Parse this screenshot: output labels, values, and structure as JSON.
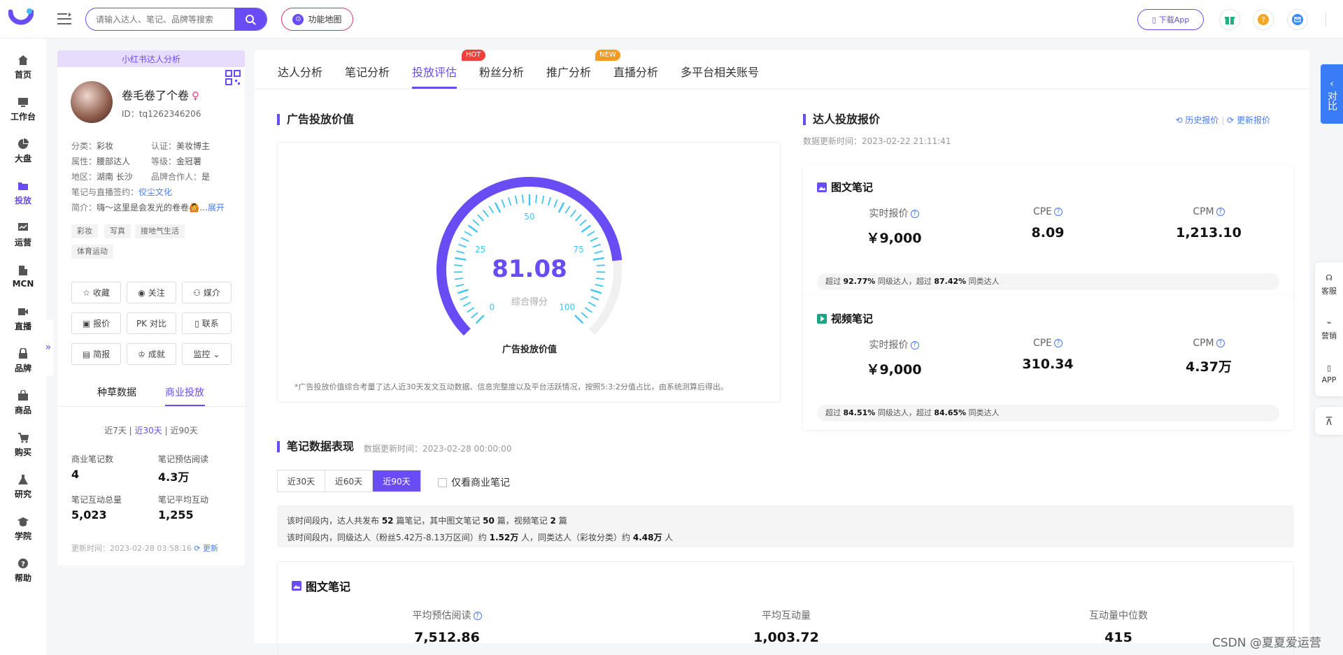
{
  "header": {
    "search_placeholder": "请输入达人、笔记、品牌等搜索",
    "feature_map": "功能地图",
    "download_app": "下载App"
  },
  "nav": [
    {
      "label": "首页",
      "icon": "home-icon"
    },
    {
      "label": "工作台",
      "icon": "workbench-icon"
    },
    {
      "label": "大盘",
      "icon": "pie-icon"
    },
    {
      "label": "投放",
      "icon": "folder-icon"
    },
    {
      "label": "运营",
      "icon": "chart-icon"
    },
    {
      "label": "MCN",
      "icon": "building-icon"
    },
    {
      "label": "直播",
      "icon": "video-icon"
    },
    {
      "label": "品牌",
      "icon": "lock-icon"
    },
    {
      "label": "商品",
      "icon": "bag-icon"
    },
    {
      "label": "购买",
      "icon": "cart-icon"
    },
    {
      "label": "研究",
      "icon": "flask-icon"
    },
    {
      "label": "学院",
      "icon": "cap-icon"
    },
    {
      "label": "帮助",
      "icon": "help-icon"
    }
  ],
  "profile": {
    "header": "小红书达人分析",
    "name": "卷毛卷了个卷",
    "gender": "♀",
    "id": "ID：tq1262346206",
    "category_k": "分类：",
    "category": "彩妆",
    "cert_k": "认证：",
    "cert": "美妆博主",
    "attr_k": "属性：",
    "attr": "腰部达人",
    "level_k": "等级：",
    "level": "金冠薯",
    "region_k": "地区：",
    "region": "湖南 长沙",
    "brand_k": "品牌合作人：",
    "brand": "是",
    "sign_k": "笔记与直播签约：",
    "sign": "佼尘文化",
    "bio_k": "简介：",
    "bio": "嗨～这里是会发光的卷卷🙆…",
    "expand": "展开",
    "tags": [
      "彩妆",
      "写真",
      "接地气生活",
      "体育运动"
    ],
    "buttons": [
      "收藏",
      "关注",
      "媒介",
      "报价",
      "对比",
      "联系",
      "简报",
      "成就",
      "监控"
    ],
    "tabs": [
      "种草数据",
      "商业投放"
    ],
    "range": {
      "d7": "近7天",
      "d30": "近30天",
      "d90": "近90天"
    },
    "stats": [
      {
        "label": "商业笔记数",
        "value": "4"
      },
      {
        "label": "笔记预估阅读",
        "value": "4.3万"
      },
      {
        "label": "笔记互动总量",
        "value": "5,023"
      },
      {
        "label": "笔记平均互动",
        "value": "1,255"
      }
    ],
    "updated": "更新时间：2023-02-28 03:58:16",
    "refresh": "更新"
  },
  "tabs": [
    "达人分析",
    "笔记分析",
    "投放评估",
    "粉丝分析",
    "推广分析",
    "直播分析",
    "多平台相关账号"
  ],
  "badges": {
    "hot": "HOT",
    "new": "NEW"
  },
  "ad_value": {
    "title": "广告投放价值",
    "score": "81.08",
    "score_value": 81.08,
    "score_label": "综合得分",
    "ticks": [
      "0",
      "25",
      "50",
      "75",
      "100"
    ],
    "gauge_caption": "广告投放价值",
    "note": "*广告投放价值综合考量了达人近30天发文互动数据、信息完整度以及平台活跃情况，按照5:3:2分值占比，由系统测算后得出。"
  },
  "quote": {
    "title": "达人投放报价",
    "updated": "数据更新时间：2023-02-22 21:11:41",
    "history": "历史报价",
    "refresh": "更新报价",
    "cards": [
      {
        "title": "图文笔记",
        "metrics": [
          {
            "label": "实时报价",
            "value": "￥9,000"
          },
          {
            "label": "CPE",
            "value": "8.09"
          },
          {
            "label": "CPM",
            "value": "1,213.10"
          }
        ],
        "foot": {
          "p1": "超过 ",
          "v1": "92.77%",
          "p2": " 同级达人，超过 ",
          "v2": "87.42%",
          "p3": " 同类达人"
        }
      },
      {
        "title": "视频笔记",
        "metrics": [
          {
            "label": "实时报价",
            "value": "￥9,000"
          },
          {
            "label": "CPE",
            "value": "310.34"
          },
          {
            "label": "CPM",
            "value": "4.37万"
          }
        ],
        "foot": {
          "p1": "超过 ",
          "v1": "84.51%",
          "p2": " 同级达人，超过 ",
          "v2": "84.65%",
          "p3": " 同类达人"
        }
      }
    ]
  },
  "notes_perf": {
    "title": "笔记数据表现",
    "updated": "数据更新时间：2023-02-28 00:00:00",
    "ranges": [
      "近30天",
      "近60天",
      "近90天"
    ],
    "only_commercial": "仅看商业笔记",
    "summary1": {
      "a": "该时间段内，达人共发布 ",
      "n1": "52",
      "b": " 篇笔记，其中图文笔记 ",
      "n2": "50",
      "c": " 篇，视频笔记 ",
      "n3": "2",
      "d": " 篇"
    },
    "summary2": {
      "a": "该时间段内，同级达人（粉丝5.42万-8.13万区间）约 ",
      "n1": "1.52万",
      "b": " 人，同类达人（彩妆分类）约 ",
      "n2": "4.48万",
      "c": " 人"
    },
    "box_title": "图文笔记",
    "metrics": [
      {
        "label": "平均预估阅读",
        "value": "7,512.86"
      },
      {
        "label": "平均互动量",
        "value": "1,003.72"
      },
      {
        "label": "互动量中位数",
        "value": "415"
      }
    ]
  },
  "right_tools": {
    "compare": "对比",
    "service": "客服",
    "marketing": "营销",
    "app": "APP"
  },
  "watermark": "CSDN @夏夏爱运营",
  "colors": {
    "accent": "#6a4cf5",
    "gauge_light": "#40c4f0",
    "link": "#4a7cf0"
  }
}
